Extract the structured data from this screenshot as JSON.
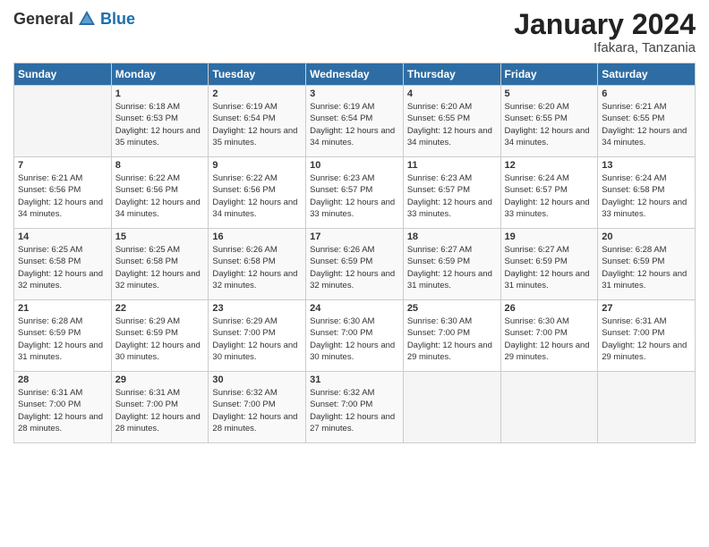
{
  "logo": {
    "general": "General",
    "blue": "Blue"
  },
  "header": {
    "month": "January 2024",
    "location": "Ifakara, Tanzania"
  },
  "weekdays": [
    "Sunday",
    "Monday",
    "Tuesday",
    "Wednesday",
    "Thursday",
    "Friday",
    "Saturday"
  ],
  "weeks": [
    [
      {
        "day": "",
        "sunrise": "",
        "sunset": "",
        "daylight": ""
      },
      {
        "day": "1",
        "sunrise": "Sunrise: 6:18 AM",
        "sunset": "Sunset: 6:53 PM",
        "daylight": "Daylight: 12 hours and 35 minutes."
      },
      {
        "day": "2",
        "sunrise": "Sunrise: 6:19 AM",
        "sunset": "Sunset: 6:54 PM",
        "daylight": "Daylight: 12 hours and 35 minutes."
      },
      {
        "day": "3",
        "sunrise": "Sunrise: 6:19 AM",
        "sunset": "Sunset: 6:54 PM",
        "daylight": "Daylight: 12 hours and 34 minutes."
      },
      {
        "day": "4",
        "sunrise": "Sunrise: 6:20 AM",
        "sunset": "Sunset: 6:55 PM",
        "daylight": "Daylight: 12 hours and 34 minutes."
      },
      {
        "day": "5",
        "sunrise": "Sunrise: 6:20 AM",
        "sunset": "Sunset: 6:55 PM",
        "daylight": "Daylight: 12 hours and 34 minutes."
      },
      {
        "day": "6",
        "sunrise": "Sunrise: 6:21 AM",
        "sunset": "Sunset: 6:55 PM",
        "daylight": "Daylight: 12 hours and 34 minutes."
      }
    ],
    [
      {
        "day": "7",
        "sunrise": "Sunrise: 6:21 AM",
        "sunset": "Sunset: 6:56 PM",
        "daylight": "Daylight: 12 hours and 34 minutes."
      },
      {
        "day": "8",
        "sunrise": "Sunrise: 6:22 AM",
        "sunset": "Sunset: 6:56 PM",
        "daylight": "Daylight: 12 hours and 34 minutes."
      },
      {
        "day": "9",
        "sunrise": "Sunrise: 6:22 AM",
        "sunset": "Sunset: 6:56 PM",
        "daylight": "Daylight: 12 hours and 34 minutes."
      },
      {
        "day": "10",
        "sunrise": "Sunrise: 6:23 AM",
        "sunset": "Sunset: 6:57 PM",
        "daylight": "Daylight: 12 hours and 33 minutes."
      },
      {
        "day": "11",
        "sunrise": "Sunrise: 6:23 AM",
        "sunset": "Sunset: 6:57 PM",
        "daylight": "Daylight: 12 hours and 33 minutes."
      },
      {
        "day": "12",
        "sunrise": "Sunrise: 6:24 AM",
        "sunset": "Sunset: 6:57 PM",
        "daylight": "Daylight: 12 hours and 33 minutes."
      },
      {
        "day": "13",
        "sunrise": "Sunrise: 6:24 AM",
        "sunset": "Sunset: 6:58 PM",
        "daylight": "Daylight: 12 hours and 33 minutes."
      }
    ],
    [
      {
        "day": "14",
        "sunrise": "Sunrise: 6:25 AM",
        "sunset": "Sunset: 6:58 PM",
        "daylight": "Daylight: 12 hours and 32 minutes."
      },
      {
        "day": "15",
        "sunrise": "Sunrise: 6:25 AM",
        "sunset": "Sunset: 6:58 PM",
        "daylight": "Daylight: 12 hours and 32 minutes."
      },
      {
        "day": "16",
        "sunrise": "Sunrise: 6:26 AM",
        "sunset": "Sunset: 6:58 PM",
        "daylight": "Daylight: 12 hours and 32 minutes."
      },
      {
        "day": "17",
        "sunrise": "Sunrise: 6:26 AM",
        "sunset": "Sunset: 6:59 PM",
        "daylight": "Daylight: 12 hours and 32 minutes."
      },
      {
        "day": "18",
        "sunrise": "Sunrise: 6:27 AM",
        "sunset": "Sunset: 6:59 PM",
        "daylight": "Daylight: 12 hours and 31 minutes."
      },
      {
        "day": "19",
        "sunrise": "Sunrise: 6:27 AM",
        "sunset": "Sunset: 6:59 PM",
        "daylight": "Daylight: 12 hours and 31 minutes."
      },
      {
        "day": "20",
        "sunrise": "Sunrise: 6:28 AM",
        "sunset": "Sunset: 6:59 PM",
        "daylight": "Daylight: 12 hours and 31 minutes."
      }
    ],
    [
      {
        "day": "21",
        "sunrise": "Sunrise: 6:28 AM",
        "sunset": "Sunset: 6:59 PM",
        "daylight": "Daylight: 12 hours and 31 minutes."
      },
      {
        "day": "22",
        "sunrise": "Sunrise: 6:29 AM",
        "sunset": "Sunset: 6:59 PM",
        "daylight": "Daylight: 12 hours and 30 minutes."
      },
      {
        "day": "23",
        "sunrise": "Sunrise: 6:29 AM",
        "sunset": "Sunset: 7:00 PM",
        "daylight": "Daylight: 12 hours and 30 minutes."
      },
      {
        "day": "24",
        "sunrise": "Sunrise: 6:30 AM",
        "sunset": "Sunset: 7:00 PM",
        "daylight": "Daylight: 12 hours and 30 minutes."
      },
      {
        "day": "25",
        "sunrise": "Sunrise: 6:30 AM",
        "sunset": "Sunset: 7:00 PM",
        "daylight": "Daylight: 12 hours and 29 minutes."
      },
      {
        "day": "26",
        "sunrise": "Sunrise: 6:30 AM",
        "sunset": "Sunset: 7:00 PM",
        "daylight": "Daylight: 12 hours and 29 minutes."
      },
      {
        "day": "27",
        "sunrise": "Sunrise: 6:31 AM",
        "sunset": "Sunset: 7:00 PM",
        "daylight": "Daylight: 12 hours and 29 minutes."
      }
    ],
    [
      {
        "day": "28",
        "sunrise": "Sunrise: 6:31 AM",
        "sunset": "Sunset: 7:00 PM",
        "daylight": "Daylight: 12 hours and 28 minutes."
      },
      {
        "day": "29",
        "sunrise": "Sunrise: 6:31 AM",
        "sunset": "Sunset: 7:00 PM",
        "daylight": "Daylight: 12 hours and 28 minutes."
      },
      {
        "day": "30",
        "sunrise": "Sunrise: 6:32 AM",
        "sunset": "Sunset: 7:00 PM",
        "daylight": "Daylight: 12 hours and 28 minutes."
      },
      {
        "day": "31",
        "sunrise": "Sunrise: 6:32 AM",
        "sunset": "Sunset: 7:00 PM",
        "daylight": "Daylight: 12 hours and 27 minutes."
      },
      {
        "day": "",
        "sunrise": "",
        "sunset": "",
        "daylight": ""
      },
      {
        "day": "",
        "sunrise": "",
        "sunset": "",
        "daylight": ""
      },
      {
        "day": "",
        "sunrise": "",
        "sunset": "",
        "daylight": ""
      }
    ]
  ]
}
